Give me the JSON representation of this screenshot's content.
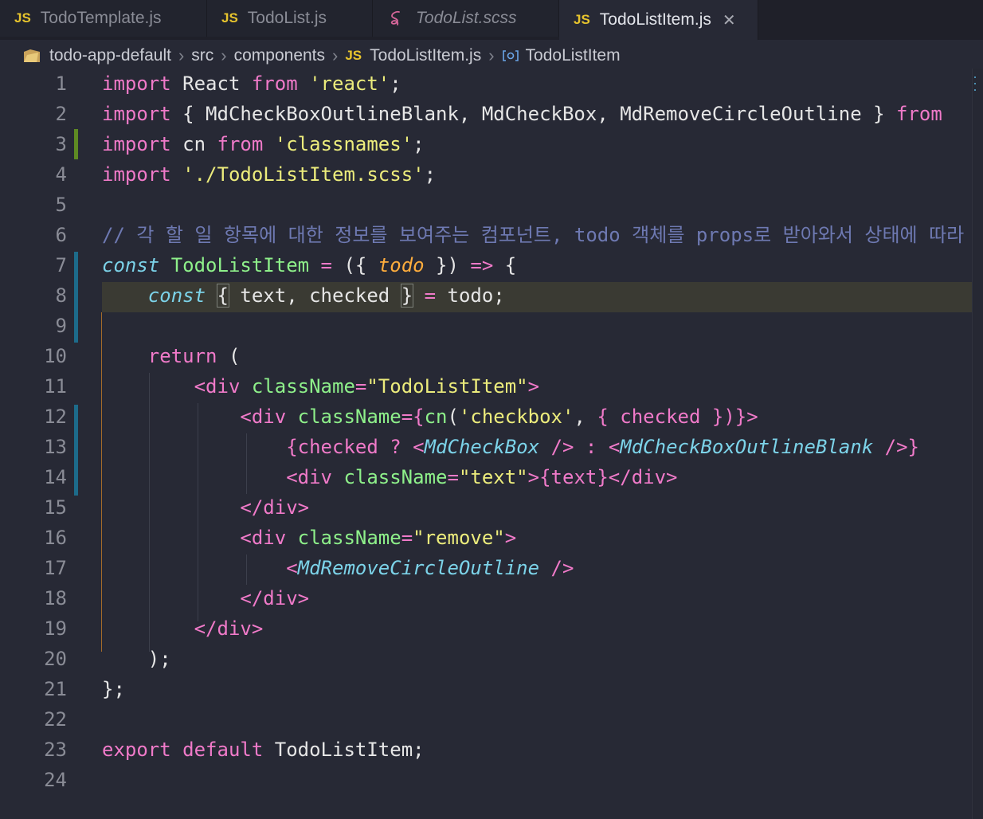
{
  "tabs": [
    {
      "badge": "JS",
      "label": "TodoTemplate.js"
    },
    {
      "badge": "JS",
      "label": "TodoList.js"
    },
    {
      "badge": "",
      "label": "TodoList.scss"
    },
    {
      "badge": "JS",
      "label": "TodoListItem.js"
    }
  ],
  "breadcrumb": {
    "project": "todo-app-default",
    "folder1": "src",
    "folder2": "components",
    "file_badge": "JS",
    "file": "TodoListItem.js",
    "symbol": "TodoListItem"
  },
  "colors": {
    "keyword": "#f07ac9",
    "string": "#ecec7c",
    "comment": "#6e79b2",
    "function": "#8ef08a",
    "component": "#7cd3e9",
    "param": "#ffad3d",
    "editor_bg": "#272935"
  },
  "icons": {
    "js": "js-file-icon",
    "sass": "sass-file-icon",
    "close": "close-icon",
    "folder": "folder-icon",
    "symbol": "symbol-component-icon"
  },
  "editor": {
    "line_numbers": [
      "1",
      "2",
      "3",
      "4",
      "5",
      "6",
      "7",
      "8",
      "9",
      "10",
      "11",
      "12",
      "13",
      "14",
      "15",
      "16",
      "17",
      "18",
      "19",
      "20",
      "21",
      "22",
      "23",
      "24"
    ],
    "lines": [
      [
        [
          "kw",
          "import"
        ],
        [
          "df",
          " React "
        ],
        [
          "kw",
          "from"
        ],
        [
          "df",
          " "
        ],
        [
          "st",
          "'react'"
        ],
        [
          "df",
          ";"
        ]
      ],
      [
        [
          "kw",
          "import"
        ],
        [
          "df",
          " { MdCheckBoxOutlineBlank, MdCheckBox, MdRemoveCircleOutline } "
        ],
        [
          "kw",
          "from"
        ]
      ],
      [
        [
          "kw",
          "import"
        ],
        [
          "df",
          " cn "
        ],
        [
          "kw",
          "from"
        ],
        [
          "df",
          " "
        ],
        [
          "st",
          "'classnames'"
        ],
        [
          "df",
          ";"
        ]
      ],
      [
        [
          "kw",
          "import"
        ],
        [
          "df",
          " "
        ],
        [
          "st",
          "'./TodoListItem.scss'"
        ],
        [
          "df",
          ";"
        ]
      ],
      [],
      [
        [
          "cm",
          "// 각 할 일 항목에 대한 정보를 보여주는 컴포넌트, todo 객체를 props로 받아와서 상태에 따라"
        ]
      ],
      [
        [
          "cn",
          "const"
        ],
        [
          "df",
          " "
        ],
        [
          "fn",
          "TodoListItem"
        ],
        [
          "df",
          " "
        ],
        [
          "op",
          "="
        ],
        [
          "df",
          " ({ "
        ],
        [
          "ar",
          "todo"
        ],
        [
          "df",
          " }) "
        ],
        [
          "op",
          "=>"
        ],
        [
          "df",
          " {"
        ]
      ],
      [
        [
          "df",
          "    "
        ],
        [
          "cn",
          "const"
        ],
        [
          "df",
          " "
        ],
        [
          "bracket",
          "{"
        ],
        [
          "df",
          " text, checked "
        ],
        [
          "bracket",
          "}"
        ],
        [
          "df",
          " "
        ],
        [
          "op",
          "="
        ],
        [
          "df",
          " todo;"
        ]
      ],
      [],
      [
        [
          "df",
          "    "
        ],
        [
          "kw",
          "return"
        ],
        [
          "df",
          " ("
        ]
      ],
      [
        [
          "df",
          "        "
        ],
        [
          "tg",
          "<div"
        ],
        [
          "df",
          " "
        ],
        [
          "at",
          "className"
        ],
        [
          "op",
          "="
        ],
        [
          "st",
          "\"TodoListItem\""
        ],
        [
          "tg",
          ">"
        ]
      ],
      [
        [
          "df",
          "            "
        ],
        [
          "tg",
          "<div"
        ],
        [
          "df",
          " "
        ],
        [
          "at",
          "className"
        ],
        [
          "op",
          "={"
        ],
        [
          "fn",
          "cn"
        ],
        [
          "df",
          "("
        ],
        [
          "st",
          "'checkbox'"
        ],
        [
          "df",
          ", "
        ],
        [
          "op",
          "{"
        ],
        [
          "df",
          " "
        ],
        [
          "kw",
          "checked"
        ],
        [
          "df",
          " "
        ],
        [
          "op",
          "})}>"
        ]
      ],
      [
        [
          "df",
          "                "
        ],
        [
          "op",
          "{"
        ],
        [
          "kw",
          "checked"
        ],
        [
          "df",
          " "
        ],
        [
          "op",
          "?"
        ],
        [
          "df",
          " "
        ],
        [
          "tg",
          "<"
        ],
        [
          "cp",
          "MdCheckBox"
        ],
        [
          "df",
          " "
        ],
        [
          "tg",
          "/>"
        ],
        [
          "df",
          " "
        ],
        [
          "op",
          ":"
        ],
        [
          "df",
          " "
        ],
        [
          "tg",
          "<"
        ],
        [
          "cp",
          "MdCheckBoxOutlineBlank"
        ],
        [
          "df",
          " "
        ],
        [
          "tg",
          "/>}"
        ]
      ],
      [
        [
          "df",
          "                "
        ],
        [
          "tg",
          "<div"
        ],
        [
          "df",
          " "
        ],
        [
          "at",
          "className"
        ],
        [
          "op",
          "="
        ],
        [
          "st",
          "\"text\""
        ],
        [
          "tg",
          ">{"
        ],
        [
          "kw",
          "text"
        ],
        [
          "tg",
          "}</div>"
        ]
      ],
      [
        [
          "df",
          "            "
        ],
        [
          "tg",
          "</div>"
        ]
      ],
      [
        [
          "df",
          "            "
        ],
        [
          "tg",
          "<div"
        ],
        [
          "df",
          " "
        ],
        [
          "at",
          "className"
        ],
        [
          "op",
          "="
        ],
        [
          "st",
          "\"remove\""
        ],
        [
          "tg",
          ">"
        ]
      ],
      [
        [
          "df",
          "                "
        ],
        [
          "tg",
          "<"
        ],
        [
          "cp",
          "MdRemoveCircleOutline"
        ],
        [
          "df",
          " "
        ],
        [
          "tg",
          "/>"
        ]
      ],
      [
        [
          "df",
          "            "
        ],
        [
          "tg",
          "</div>"
        ]
      ],
      [
        [
          "df",
          "        "
        ],
        [
          "tg",
          "</div>"
        ]
      ],
      [
        [
          "df",
          "    );"
        ]
      ],
      [
        [
          "df",
          "};"
        ]
      ],
      [],
      [
        [
          "kw",
          "export"
        ],
        [
          "df",
          " "
        ],
        [
          "kw",
          "default"
        ],
        [
          "df",
          " TodoListItem;"
        ]
      ],
      []
    ]
  }
}
